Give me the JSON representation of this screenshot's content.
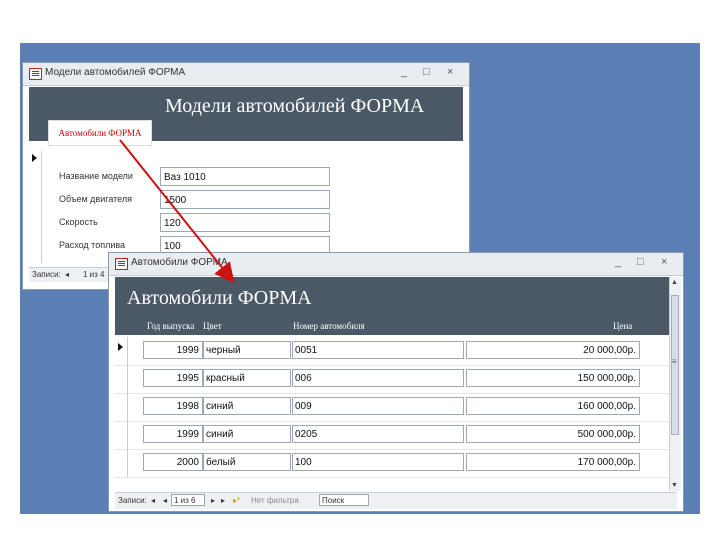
{
  "window1": {
    "title": "Модели автомобилей ФОРМА",
    "min": "_",
    "max": "□",
    "close": "×",
    "header_title": "Модели автомобилей ФОРМА",
    "subform_link": "Автомобили ФОРМА",
    "fields": [
      {
        "label": "Название модели",
        "value": "Ваз 1010"
      },
      {
        "label": "Объем двигателя",
        "value": "1500"
      },
      {
        "label": "Скорость",
        "value": "120"
      },
      {
        "label": "Расход топлива",
        "value": "100"
      }
    ],
    "nav": {
      "records_label": "Записи:",
      "first": "◂",
      "position": "1 из 4"
    }
  },
  "window2": {
    "title": "Автомобили ФОРМА",
    "min": "_",
    "max": "□",
    "close": "×",
    "header_title": "Автомобили ФОРМА",
    "columns": [
      "Год выпуска",
      "Цвет",
      "Номер автомобиля",
      "Цена"
    ],
    "rows": [
      {
        "year": "1999",
        "color": "черный",
        "number": "0051",
        "price": "20 000,00р."
      },
      {
        "year": "1995",
        "color": "красный",
        "number": "006",
        "price": "150 000,00р."
      },
      {
        "year": "1998",
        "color": "синий",
        "number": "009",
        "price": "160 000,00р."
      },
      {
        "year": "1999",
        "color": "синий",
        "number": "0205",
        "price": "500 000,00р."
      },
      {
        "year": "2000",
        "color": "белый",
        "number": "100",
        "price": "170 000,00р."
      }
    ],
    "nav": {
      "records_label": "Записи:",
      "first": "◂",
      "prev": "◂",
      "position": "1 из 6",
      "next": "▸",
      "last": "▸",
      "new": "▸*",
      "filter": "Нет фильтра",
      "search": "Поиск"
    }
  },
  "colors": {
    "slide_background": "#5b7fb5",
    "form_header": "#4b5865",
    "arrow": "#cc1111",
    "link_text": "#cc0000"
  }
}
